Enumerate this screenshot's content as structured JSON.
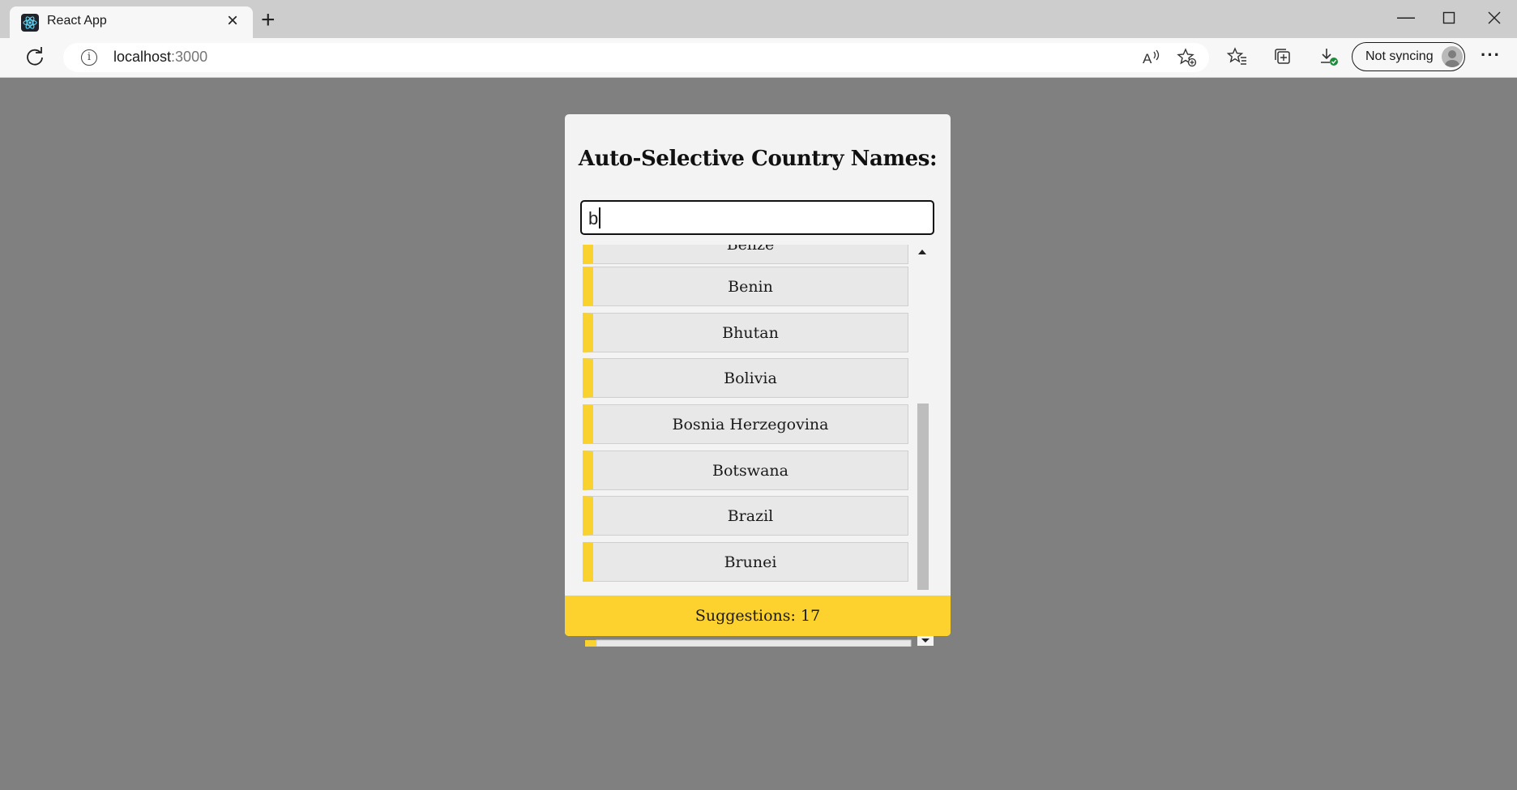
{
  "browser": {
    "tab_title": "React App",
    "url_host": "localhost",
    "url_port": ":3000",
    "sync_label": "Not syncing"
  },
  "app": {
    "title": "Auto-Selective Country Names:",
    "search_value": "b",
    "suggestions": [
      {
        "name": "Belize"
      },
      {
        "name": "Benin"
      },
      {
        "name": "Bhutan"
      },
      {
        "name": "Bolivia"
      },
      {
        "name": "Bosnia Herzegovina"
      },
      {
        "name": "Botswana"
      },
      {
        "name": "Brazil"
      },
      {
        "name": "Brunei"
      }
    ],
    "footer_text": "Suggestions: 17"
  },
  "colors": {
    "page_background": "#808080",
    "accent_yellow": "#fdd22f",
    "item_background": "#e8e8e8"
  }
}
